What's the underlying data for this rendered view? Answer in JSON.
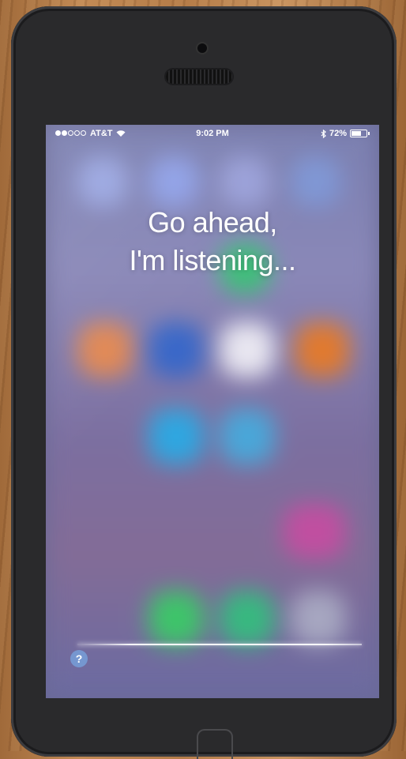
{
  "status_bar": {
    "carrier": "AT&T",
    "signal_bars_filled": 2,
    "signal_bars_total": 5,
    "time": "9:02 PM",
    "bluetooth_icon": "bluetooth-icon",
    "battery_percent": "72%",
    "battery_level": 0.72
  },
  "siri": {
    "prompt_line1": "Go ahead,",
    "prompt_line2": "I'm listening...",
    "help_label": "?"
  },
  "colors": {
    "screen_tint": "#7a7fb0",
    "waveform": "#ffffff",
    "help_button": "#78aae6"
  }
}
